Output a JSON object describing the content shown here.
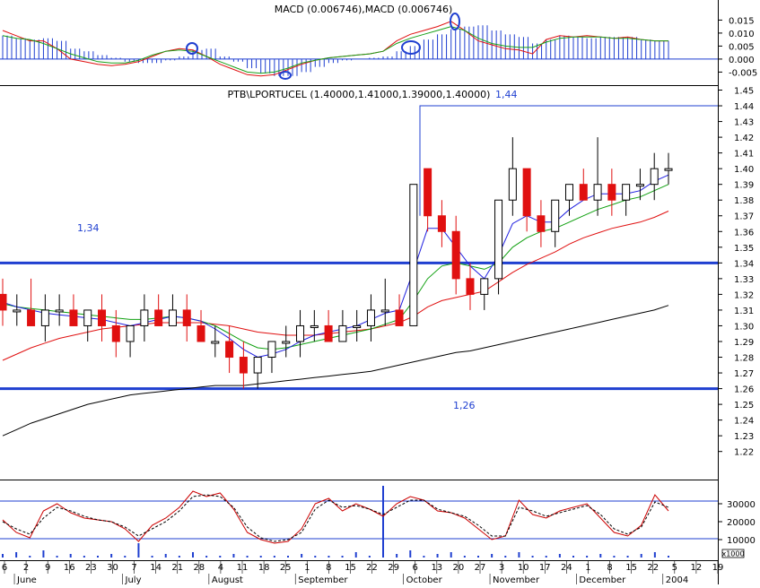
{
  "chart_data": [
    {
      "type": "bar",
      "title_parts": [
        "MACD (0.006746)",
        "MACD (0.006746)"
      ],
      "ylim": [
        -0.009,
        0.021
      ],
      "yticks": [
        "0.015",
        "0.010",
        "0.005",
        "0.000",
        "-0.005"
      ],
      "ytick_values": [
        0.015,
        0.01,
        0.005,
        0.0,
        -0.005
      ],
      "series": [
        {
          "name": "MACD (0.006746)",
          "kind": "histogram",
          "color": "#1f3fd0",
          "values": [
            0.009,
            0.008,
            0.0075,
            0.008,
            0.007,
            0.004,
            0.003,
            0.0015,
            0.0005,
            -0.001,
            -0.0015,
            -0.0015,
            -0.0005,
            0.001,
            0.0035,
            0.004,
            0.001,
            -0.001,
            -0.0035,
            -0.0055,
            -0.0065,
            -0.0065,
            -0.005,
            -0.003,
            -0.0015,
            -0.0005,
            0,
            0.0005,
            0.001,
            0.003,
            0.005,
            0.0075,
            0.0095,
            0.0115,
            0.0125,
            0.013,
            0.011,
            0.0095,
            0.0085,
            0.006,
            0.0075,
            0.009,
            0.0085,
            0.008,
            0.0085,
            0.0085,
            0.0085,
            0.0075,
            0.007,
            0.007
          ]
        },
        {
          "name": "MACD (0.006746)",
          "kind": "line",
          "color": "#e01010",
          "values": [
            0.011,
            0.009,
            0.007,
            0.007,
            0.004,
            0.0,
            -0.001,
            -0.002,
            -0.0025,
            -0.002,
            -0.001,
            0.001,
            0.003,
            0.004,
            0.0035,
            0.001,
            -0.002,
            -0.004,
            -0.006,
            -0.0065,
            -0.006,
            -0.004,
            -0.002,
            -0.0005,
            0.0005,
            0.001,
            0.0015,
            0.002,
            0.003,
            0.007,
            0.0095,
            0.011,
            0.0125,
            0.0145,
            0.011,
            0.007,
            0.0055,
            0.004,
            0.0035,
            0.002,
            0.0075,
            0.009,
            0.0085,
            0.009,
            0.0085,
            0.008,
            0.0085,
            0.0075,
            0.007,
            0.007
          ]
        },
        {
          "name": "signal",
          "kind": "line",
          "color": "#18a018",
          "values": [
            0.009,
            0.008,
            0.0075,
            0.006,
            0.004,
            0.002,
            0.0005,
            -0.001,
            -0.0015,
            -0.0015,
            -0.0005,
            0.0015,
            0.003,
            0.0035,
            0.003,
            0.001,
            -0.001,
            -0.003,
            -0.005,
            -0.0055,
            -0.005,
            -0.0035,
            -0.0015,
            -0.0005,
            0.0005,
            0.001,
            0.0015,
            0.002,
            0.003,
            0.006,
            0.008,
            0.0095,
            0.011,
            0.0125,
            0.011,
            0.008,
            0.006,
            0.005,
            0.0045,
            0.0045,
            0.0065,
            0.008,
            0.0085,
            0.0085,
            0.0085,
            0.008,
            0.008,
            0.0075,
            0.007,
            0.007
          ]
        }
      ]
    },
    {
      "type": "line",
      "title": "PTB\\LPORTUCEL (1.40000,1.41000,1.39000,1.40000)",
      "ylim": [
        1.205,
        1.452
      ],
      "yticks": [
        "1.45",
        "1.44",
        "1.43",
        "1.42",
        "1.41",
        "1.40",
        "1.39",
        "1.38",
        "1.37",
        "1.36",
        "1.35",
        "1.34",
        "1.33",
        "1.32",
        "1.31",
        "1.30",
        "1.29",
        "1.28",
        "1.27",
        "1.26",
        "1.25",
        "1.24",
        "1.23",
        "1.22"
      ],
      "annotations": [
        {
          "text": "1,44",
          "value": 1.44
        },
        {
          "text": "1,34",
          "value": 1.34
        },
        {
          "text": "1,26",
          "value": 1.26
        }
      ],
      "horizontal_lines": [
        1.44,
        1.34,
        1.26
      ],
      "candles": [
        [
          1.32,
          1.33,
          1.3,
          1.31
        ],
        [
          1.31,
          1.32,
          1.3,
          1.31
        ],
        [
          1.31,
          1.33,
          1.3,
          1.3
        ],
        [
          1.3,
          1.32,
          1.29,
          1.31
        ],
        [
          1.31,
          1.32,
          1.3,
          1.31
        ],
        [
          1.31,
          1.32,
          1.3,
          1.3
        ],
        [
          1.3,
          1.31,
          1.29,
          1.31
        ],
        [
          1.31,
          1.32,
          1.29,
          1.3
        ],
        [
          1.3,
          1.31,
          1.28,
          1.29
        ],
        [
          1.29,
          1.3,
          1.28,
          1.3
        ],
        [
          1.3,
          1.32,
          1.29,
          1.31
        ],
        [
          1.31,
          1.32,
          1.3,
          1.3
        ],
        [
          1.3,
          1.32,
          1.3,
          1.31
        ],
        [
          1.31,
          1.32,
          1.29,
          1.3
        ],
        [
          1.3,
          1.31,
          1.29,
          1.29
        ],
        [
          1.29,
          1.3,
          1.28,
          1.29
        ],
        [
          1.29,
          1.3,
          1.27,
          1.28
        ],
        [
          1.28,
          1.29,
          1.26,
          1.27
        ],
        [
          1.27,
          1.28,
          1.26,
          1.28
        ],
        [
          1.28,
          1.29,
          1.27,
          1.29
        ],
        [
          1.29,
          1.3,
          1.28,
          1.29
        ],
        [
          1.29,
          1.31,
          1.28,
          1.3
        ],
        [
          1.3,
          1.31,
          1.29,
          1.3
        ],
        [
          1.3,
          1.31,
          1.29,
          1.29
        ],
        [
          1.29,
          1.31,
          1.29,
          1.3
        ],
        [
          1.3,
          1.31,
          1.29,
          1.3
        ],
        [
          1.3,
          1.32,
          1.29,
          1.31
        ],
        [
          1.31,
          1.33,
          1.3,
          1.31
        ],
        [
          1.31,
          1.32,
          1.3,
          1.3
        ],
        [
          1.3,
          1.38,
          1.3,
          1.39
        ],
        [
          1.4,
          1.4,
          1.36,
          1.37
        ],
        [
          1.37,
          1.38,
          1.35,
          1.36
        ],
        [
          1.36,
          1.37,
          1.32,
          1.33
        ],
        [
          1.33,
          1.34,
          1.31,
          1.32
        ],
        [
          1.32,
          1.33,
          1.31,
          1.33
        ],
        [
          1.33,
          1.38,
          1.32,
          1.38
        ],
        [
          1.38,
          1.42,
          1.37,
          1.4
        ],
        [
          1.4,
          1.4,
          1.36,
          1.37
        ],
        [
          1.37,
          1.38,
          1.35,
          1.36
        ],
        [
          1.36,
          1.38,
          1.35,
          1.38
        ],
        [
          1.38,
          1.39,
          1.37,
          1.39
        ],
        [
          1.39,
          1.4,
          1.38,
          1.38
        ],
        [
          1.38,
          1.42,
          1.37,
          1.39
        ],
        [
          1.39,
          1.4,
          1.37,
          1.38
        ],
        [
          1.38,
          1.39,
          1.37,
          1.39
        ],
        [
          1.39,
          1.4,
          1.38,
          1.39
        ],
        [
          1.39,
          1.41,
          1.38,
          1.4
        ],
        [
          1.4,
          1.41,
          1.39,
          1.4
        ]
      ],
      "series": [
        {
          "name": "ma-short",
          "color": "#2020e0",
          "values": [
            1.315,
            1.312,
            1.31,
            1.308,
            1.307,
            1.306,
            1.305,
            1.304,
            1.302,
            1.3,
            1.302,
            1.304,
            1.306,
            1.305,
            1.303,
            1.298,
            1.292,
            1.285,
            1.28,
            1.282,
            1.285,
            1.29,
            1.294,
            1.296,
            1.298,
            1.3,
            1.304,
            1.308,
            1.31,
            1.335,
            1.362,
            1.362,
            1.35,
            1.338,
            1.33,
            1.345,
            1.365,
            1.37,
            1.366,
            1.366,
            1.374,
            1.38,
            1.384,
            1.384,
            1.384,
            1.386,
            1.392,
            1.396
          ]
        },
        {
          "name": "ma-medium",
          "color": "#10a010",
          "values": [
            1.314,
            1.312,
            1.311,
            1.31,
            1.309,
            1.308,
            1.307,
            1.306,
            1.305,
            1.304,
            1.304,
            1.305,
            1.306,
            1.305,
            1.303,
            1.3,
            1.295,
            1.29,
            1.286,
            1.285,
            1.286,
            1.288,
            1.29,
            1.292,
            1.294,
            1.296,
            1.298,
            1.301,
            1.304,
            1.316,
            1.33,
            1.338,
            1.34,
            1.338,
            1.336,
            1.34,
            1.35,
            1.356,
            1.36,
            1.362,
            1.366,
            1.37,
            1.374,
            1.377,
            1.38,
            1.382,
            1.386,
            1.39
          ]
        },
        {
          "name": "ma-long",
          "color": "#e01010",
          "values": [
            1.278,
            1.282,
            1.286,
            1.289,
            1.292,
            1.294,
            1.296,
            1.298,
            1.299,
            1.3,
            1.301,
            1.302,
            1.302,
            1.302,
            1.302,
            1.301,
            1.3,
            1.298,
            1.296,
            1.295,
            1.294,
            1.294,
            1.294,
            1.295,
            1.296,
            1.297,
            1.298,
            1.3,
            1.302,
            1.306,
            1.312,
            1.316,
            1.318,
            1.32,
            1.322,
            1.328,
            1.334,
            1.339,
            1.343,
            1.347,
            1.352,
            1.356,
            1.359,
            1.362,
            1.364,
            1.366,
            1.369,
            1.373
          ]
        },
        {
          "name": "ma-200",
          "color": "#000000",
          "values": [
            1.23,
            1.234,
            1.238,
            1.241,
            1.244,
            1.247,
            1.25,
            1.252,
            1.254,
            1.256,
            1.257,
            1.258,
            1.259,
            1.26,
            1.261,
            1.262,
            1.262,
            1.262,
            1.263,
            1.264,
            1.265,
            1.266,
            1.267,
            1.268,
            1.269,
            1.27,
            1.271,
            1.273,
            1.275,
            1.277,
            1.279,
            1.281,
            1.283,
            1.284,
            1.286,
            1.288,
            1.29,
            1.292,
            1.294,
            1.296,
            1.298,
            1.3,
            1.302,
            1.304,
            1.306,
            1.308,
            1.31,
            1.313
          ]
        }
      ]
    },
    {
      "type": "line",
      "title": "",
      "ylim": [
        0,
        42000
      ],
      "yticks": [
        "30000",
        "20000",
        "10000"
      ],
      "ytick_values": [
        30000,
        20000,
        10000
      ],
      "unit_label": "x1000",
      "horizontal_lines": [
        31500,
        10500
      ],
      "series": [
        {
          "name": "volume-indicator",
          "color": "#cc0000",
          "values": [
            21000,
            14000,
            11000,
            26000,
            30000,
            25000,
            22000,
            21000,
            20000,
            16000,
            9000,
            18000,
            22000,
            28000,
            37000,
            34000,
            36000,
            27000,
            14000,
            10000,
            8000,
            9000,
            16000,
            30000,
            33000,
            26000,
            30000,
            27000,
            23000,
            30000,
            34000,
            32000,
            26000,
            25000,
            22000,
            16000,
            10000,
            12000,
            32000,
            24000,
            22000,
            26000,
            28000,
            30000,
            22000,
            14000,
            12000,
            18000,
            35000,
            26000
          ]
        },
        {
          "name": "volume-signal",
          "color": "#000000",
          "dashed": true,
          "values": [
            20000,
            16000,
            13000,
            22000,
            28000,
            26000,
            23000,
            21000,
            20000,
            17000,
            12000,
            16000,
            20000,
            26000,
            34000,
            35000,
            34000,
            28000,
            17000,
            11000,
            9000,
            10000,
            14000,
            27000,
            32000,
            28000,
            29000,
            27000,
            24000,
            28000,
            32000,
            32000,
            27000,
            25000,
            23000,
            18000,
            12000,
            12000,
            28000,
            26000,
            23000,
            25000,
            27000,
            29000,
            24000,
            16000,
            13000,
            17000,
            31000,
            28000
          ]
        }
      ],
      "volume_bars": [
        2,
        3,
        1,
        4,
        1,
        2,
        1,
        1,
        2,
        1,
        8,
        1,
        2,
        1,
        3,
        1,
        1,
        2,
        1,
        1,
        1,
        1,
        2,
        1,
        1,
        1,
        3,
        1,
        40,
        2,
        4,
        1,
        2,
        3,
        1,
        1,
        2,
        1,
        3,
        1,
        1,
        2,
        1,
        1,
        2,
        1,
        1,
        2,
        3,
        1
      ]
    }
  ],
  "x_axis": {
    "tick_labels": [
      "6",
      "2",
      "9",
      "16",
      "23",
      "30",
      "7",
      "14",
      "21",
      "28",
      "4",
      "11",
      "18",
      "25",
      "1",
      "8",
      "15",
      "22",
      "29",
      "6",
      "13",
      "20",
      "27",
      "3",
      "10",
      "17",
      "24",
      "1",
      "8",
      "15",
      "22",
      "5",
      "12",
      "19"
    ],
    "month_labels": [
      "June",
      "July",
      "August",
      "September",
      "October",
      "November",
      "December",
      "2004"
    ]
  }
}
